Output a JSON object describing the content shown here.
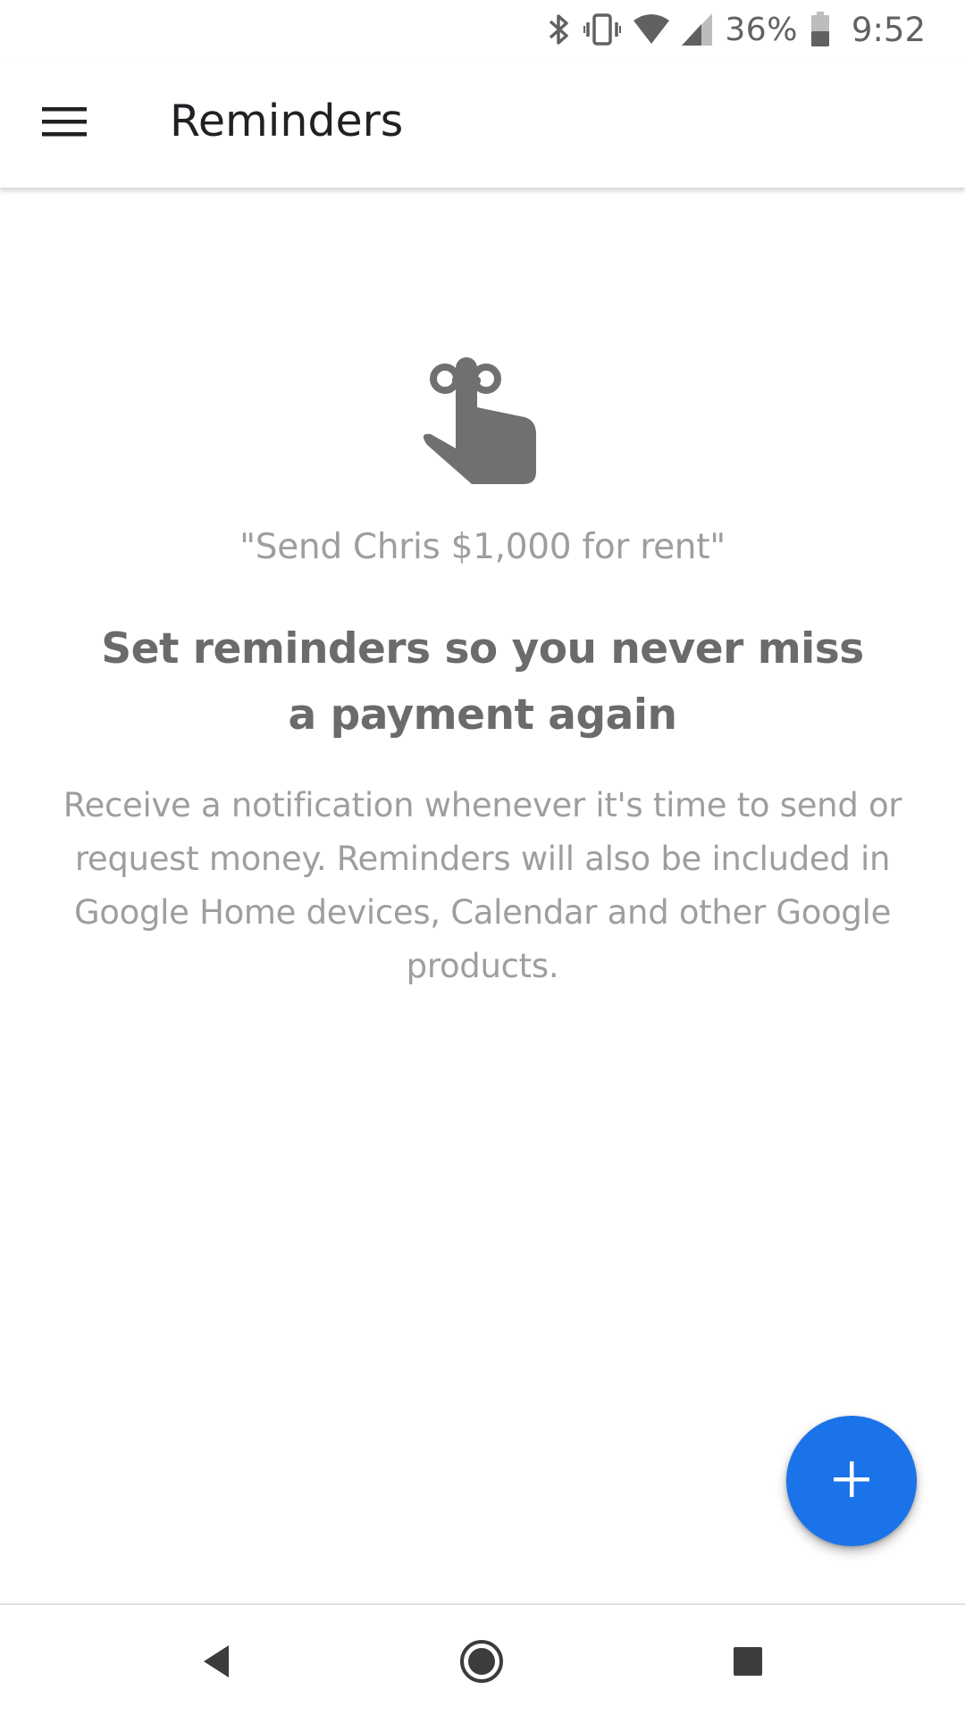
{
  "status_bar": {
    "battery_percent": "36%",
    "time": "9:52",
    "icons": [
      "bluetooth-icon",
      "vibrate-icon",
      "wifi-icon",
      "cell-signal-icon",
      "battery-icon"
    ]
  },
  "app_bar": {
    "title": "Reminders",
    "menu_icon": "hamburger-menu-icon"
  },
  "empty_state": {
    "illustration": "finger-with-string-icon",
    "example": "\"Send Chris $1,000 for rent\"",
    "headline": "Set reminders so you never miss a payment again",
    "description": "Receive a notification whenever it's time to send or request money. Reminders will also be included in Google Home devices, Calendar and other Google products."
  },
  "fab": {
    "icon": "plus-icon",
    "color": "#1a73e8"
  },
  "nav_bar": {
    "buttons": [
      "back-icon",
      "home-icon",
      "recents-icon"
    ]
  },
  "colors": {
    "accent": "#1a73e8",
    "text_primary": "#202124",
    "text_secondary": "#9e9e9e",
    "headline": "#6b6b6b",
    "icon_gray": "#707070"
  }
}
